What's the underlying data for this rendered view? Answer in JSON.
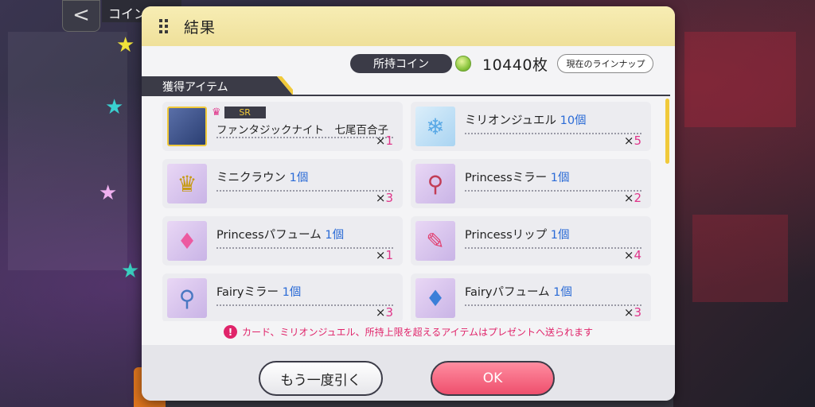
{
  "background": {
    "back_icon": "chevron-left-icon",
    "back_symbol": "<",
    "header_tab": "コイン"
  },
  "dialog": {
    "title": "結果",
    "coin_label": "所持コイン",
    "coin_icon": "coin-icon",
    "coin_amount": "10440枚",
    "lineup_button": "現在のラインナップ",
    "section_label": "獲得アイテム",
    "notice_icon": "!",
    "notice": "カード、ミリオンジュエル、所持上限を超えるアイテムはプレゼントへ送られます",
    "again_button": "もう一度引く",
    "ok_button": "OK"
  },
  "items": [
    {
      "kind": "card",
      "rarity": "SR",
      "name": "ファンタジックナイト　七尾百合子",
      "qty": "",
      "count_prefix": "×",
      "count": "1",
      "icon": "card-portrait-icon"
    },
    {
      "kind": "gem",
      "name": "ミリオンジュエル",
      "qty": "10個",
      "count_prefix": "×",
      "count": "5",
      "icon": "million-jewel-icon",
      "glyph": "❄"
    },
    {
      "kind": "crown",
      "name": "ミニクラウン",
      "qty": "1個",
      "count_prefix": "×",
      "count": "3",
      "icon": "mini-crown-icon",
      "glyph": "♛"
    },
    {
      "kind": "mirror",
      "name": "Princessミラー",
      "qty": "1個",
      "count_prefix": "×",
      "count": "2",
      "icon": "princess-mirror-icon",
      "glyph": "⚲"
    },
    {
      "kind": "perfume-p",
      "name": "Princessパフューム",
      "qty": "1個",
      "count_prefix": "×",
      "count": "1",
      "icon": "princess-perfume-icon",
      "glyph": "♦"
    },
    {
      "kind": "lip",
      "name": "Princessリップ",
      "qty": "1個",
      "count_prefix": "×",
      "count": "4",
      "icon": "princess-lip-icon",
      "glyph": "✎"
    },
    {
      "kind": "mirror-b",
      "name": "Fairyミラー",
      "qty": "1個",
      "count_prefix": "×",
      "count": "3",
      "icon": "fairy-mirror-icon",
      "glyph": "⚲"
    },
    {
      "kind": "perfume-b",
      "name": "Fairyパフューム",
      "qty": "1個",
      "count_prefix": "×",
      "count": "3",
      "icon": "fairy-perfume-icon",
      "glyph": "♦"
    }
  ],
  "colors": {
    "accent_yellow": "#f0c93a",
    "dark": "#3b3b47",
    "quantity_blue": "#2b6bd6",
    "count_pink": "#e0358a",
    "ok_pink": "#ee4f6d"
  }
}
